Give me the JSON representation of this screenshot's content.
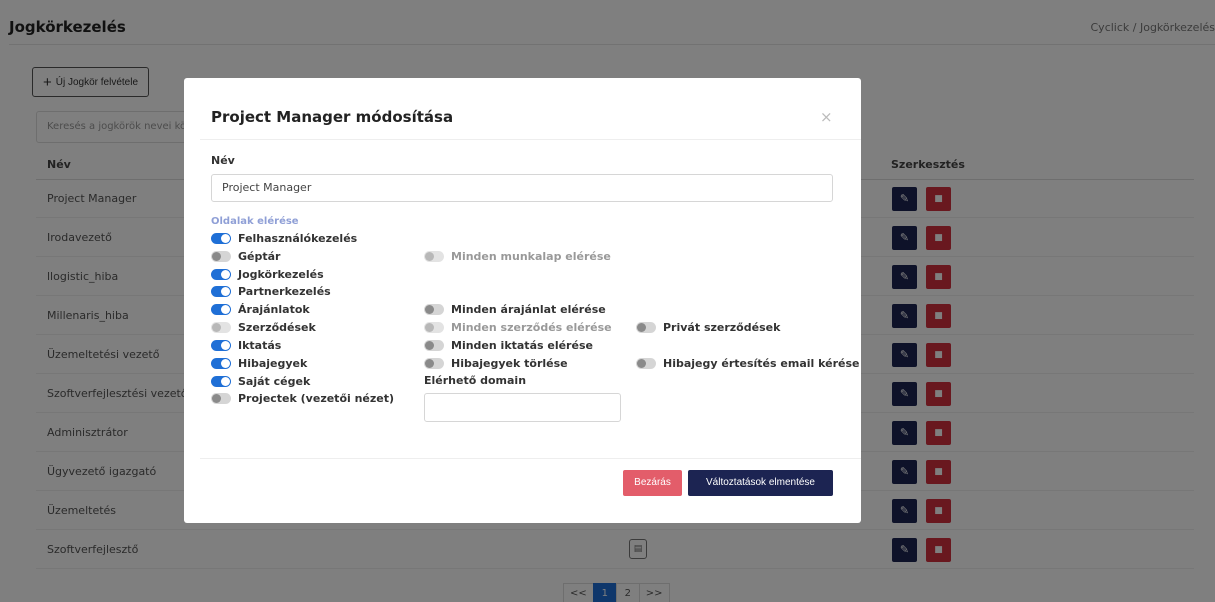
{
  "page": {
    "title": "Jogkörkezelés",
    "breadcrumb": "Cyclick / Jogkörkezelés",
    "new_button_label": "Új Jogkör felvétele",
    "search_placeholder": "Keresés a jogkörök nevei között",
    "table_headers": {
      "name": "Név",
      "edit": "Szerkesztés"
    },
    "rows": [
      {
        "name": "Project Manager"
      },
      {
        "name": "Irodavezető"
      },
      {
        "name": "llogistic_hiba"
      },
      {
        "name": "Millenaris_hiba"
      },
      {
        "name": "Üzemeltetési vezető"
      },
      {
        "name": "Szoftverfejlesztési vezető"
      },
      {
        "name": "Adminisztrátor"
      },
      {
        "name": "Ügyvezető igazgató"
      },
      {
        "name": "Üzemeltetés"
      },
      {
        "name": "Szoftverfejlesztő"
      }
    ],
    "pagination": [
      "<<",
      "1",
      "2",
      ">>"
    ],
    "current_page": "1"
  },
  "modal": {
    "title": "Project Manager módosítása",
    "close_symbol": "×",
    "name_label": "Név",
    "name_value": "Project Manager",
    "section_label": "Oldalak elérése",
    "permissions": [
      {
        "label": "Felhasználókezelés",
        "on": true
      },
      {
        "label": "Géptár",
        "on": false
      },
      {
        "label": "Minden munkalap elérése",
        "on": false,
        "disabled": true
      },
      {
        "label": "Jogkörkezelés",
        "on": true
      },
      {
        "label": "Partnerkezelés",
        "on": true
      },
      {
        "label": "Árajánlatok",
        "on": true
      },
      {
        "label": "Minden árajánlat elérése",
        "on": false
      },
      {
        "label": "Szerződések",
        "on": false,
        "disabled": true
      },
      {
        "label": "Minden szerződés elérése",
        "on": false,
        "disabled": true
      },
      {
        "label": "Privát szerződések",
        "on": false
      },
      {
        "label": "Iktatás",
        "on": true
      },
      {
        "label": "Minden iktatás elérése",
        "on": false
      },
      {
        "label": "Hibajegyek",
        "on": true
      },
      {
        "label": "Hibajegyek törlése",
        "on": false
      },
      {
        "label": "Hibajegy értesítés email kérése",
        "on": false
      },
      {
        "label": "Saját cégek",
        "on": true
      },
      {
        "label": "Projectek (vezetői nézet)",
        "on": false
      }
    ],
    "domain_label": "Elérhető domain",
    "domain_value": "",
    "close_button": "Bezárás",
    "save_button": "Változtatások elmentése"
  },
  "colors": {
    "primary_dark": "#1c2452",
    "toggle_on": "#1f6fd6",
    "danger": "#d2313f",
    "close_button": "#e35d6a",
    "section_label": "#8f9fd6"
  },
  "icons": {
    "edit": "pencil-icon",
    "delete": "trash-icon",
    "close": "close-icon",
    "add": "plus-icon",
    "document": "document-icon"
  }
}
